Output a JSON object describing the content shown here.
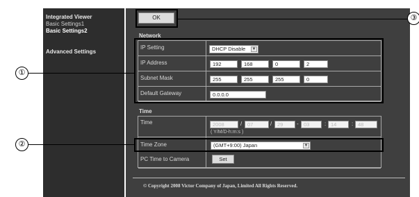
{
  "sidebar": {
    "items": [
      {
        "label": "Integrated Viewer"
      },
      {
        "label": "Basic Settings1"
      },
      {
        "label": "Basic Settings2"
      },
      {
        "label": "Advanced Settings"
      }
    ]
  },
  "toolbar": {
    "ok_label": "OK"
  },
  "network": {
    "title": "Network",
    "ip_setting": {
      "label": "IP Setting",
      "value": "DHCP Disable"
    },
    "ip_address": {
      "label": "IP Address",
      "octets": [
        "192",
        "168",
        "0",
        "2"
      ]
    },
    "subnet_mask": {
      "label": "Subnet Mask",
      "octets": [
        "255",
        "255",
        "255",
        "0"
      ]
    },
    "default_gateway": {
      "label": "Default Gateway",
      "value": "0.0.0.0"
    }
  },
  "time": {
    "title": "Time",
    "time_row": {
      "label": "Time",
      "year": "2008",
      "month": "07",
      "day": "29",
      "hour": "03",
      "minute": "14",
      "second": "48",
      "format_hint": "( Y/M/D-h:m:s )"
    },
    "time_zone": {
      "label": "Time Zone",
      "value": "(GMT+9:00) Japan"
    },
    "pc_time": {
      "label": "PC Time to Camera",
      "button_label": "Set"
    }
  },
  "footer": {
    "copyright": "© Copyright 2008 Victor Company of Japan, Limited All Rights Reserved."
  },
  "callouts": [
    "①",
    "②",
    "③"
  ]
}
